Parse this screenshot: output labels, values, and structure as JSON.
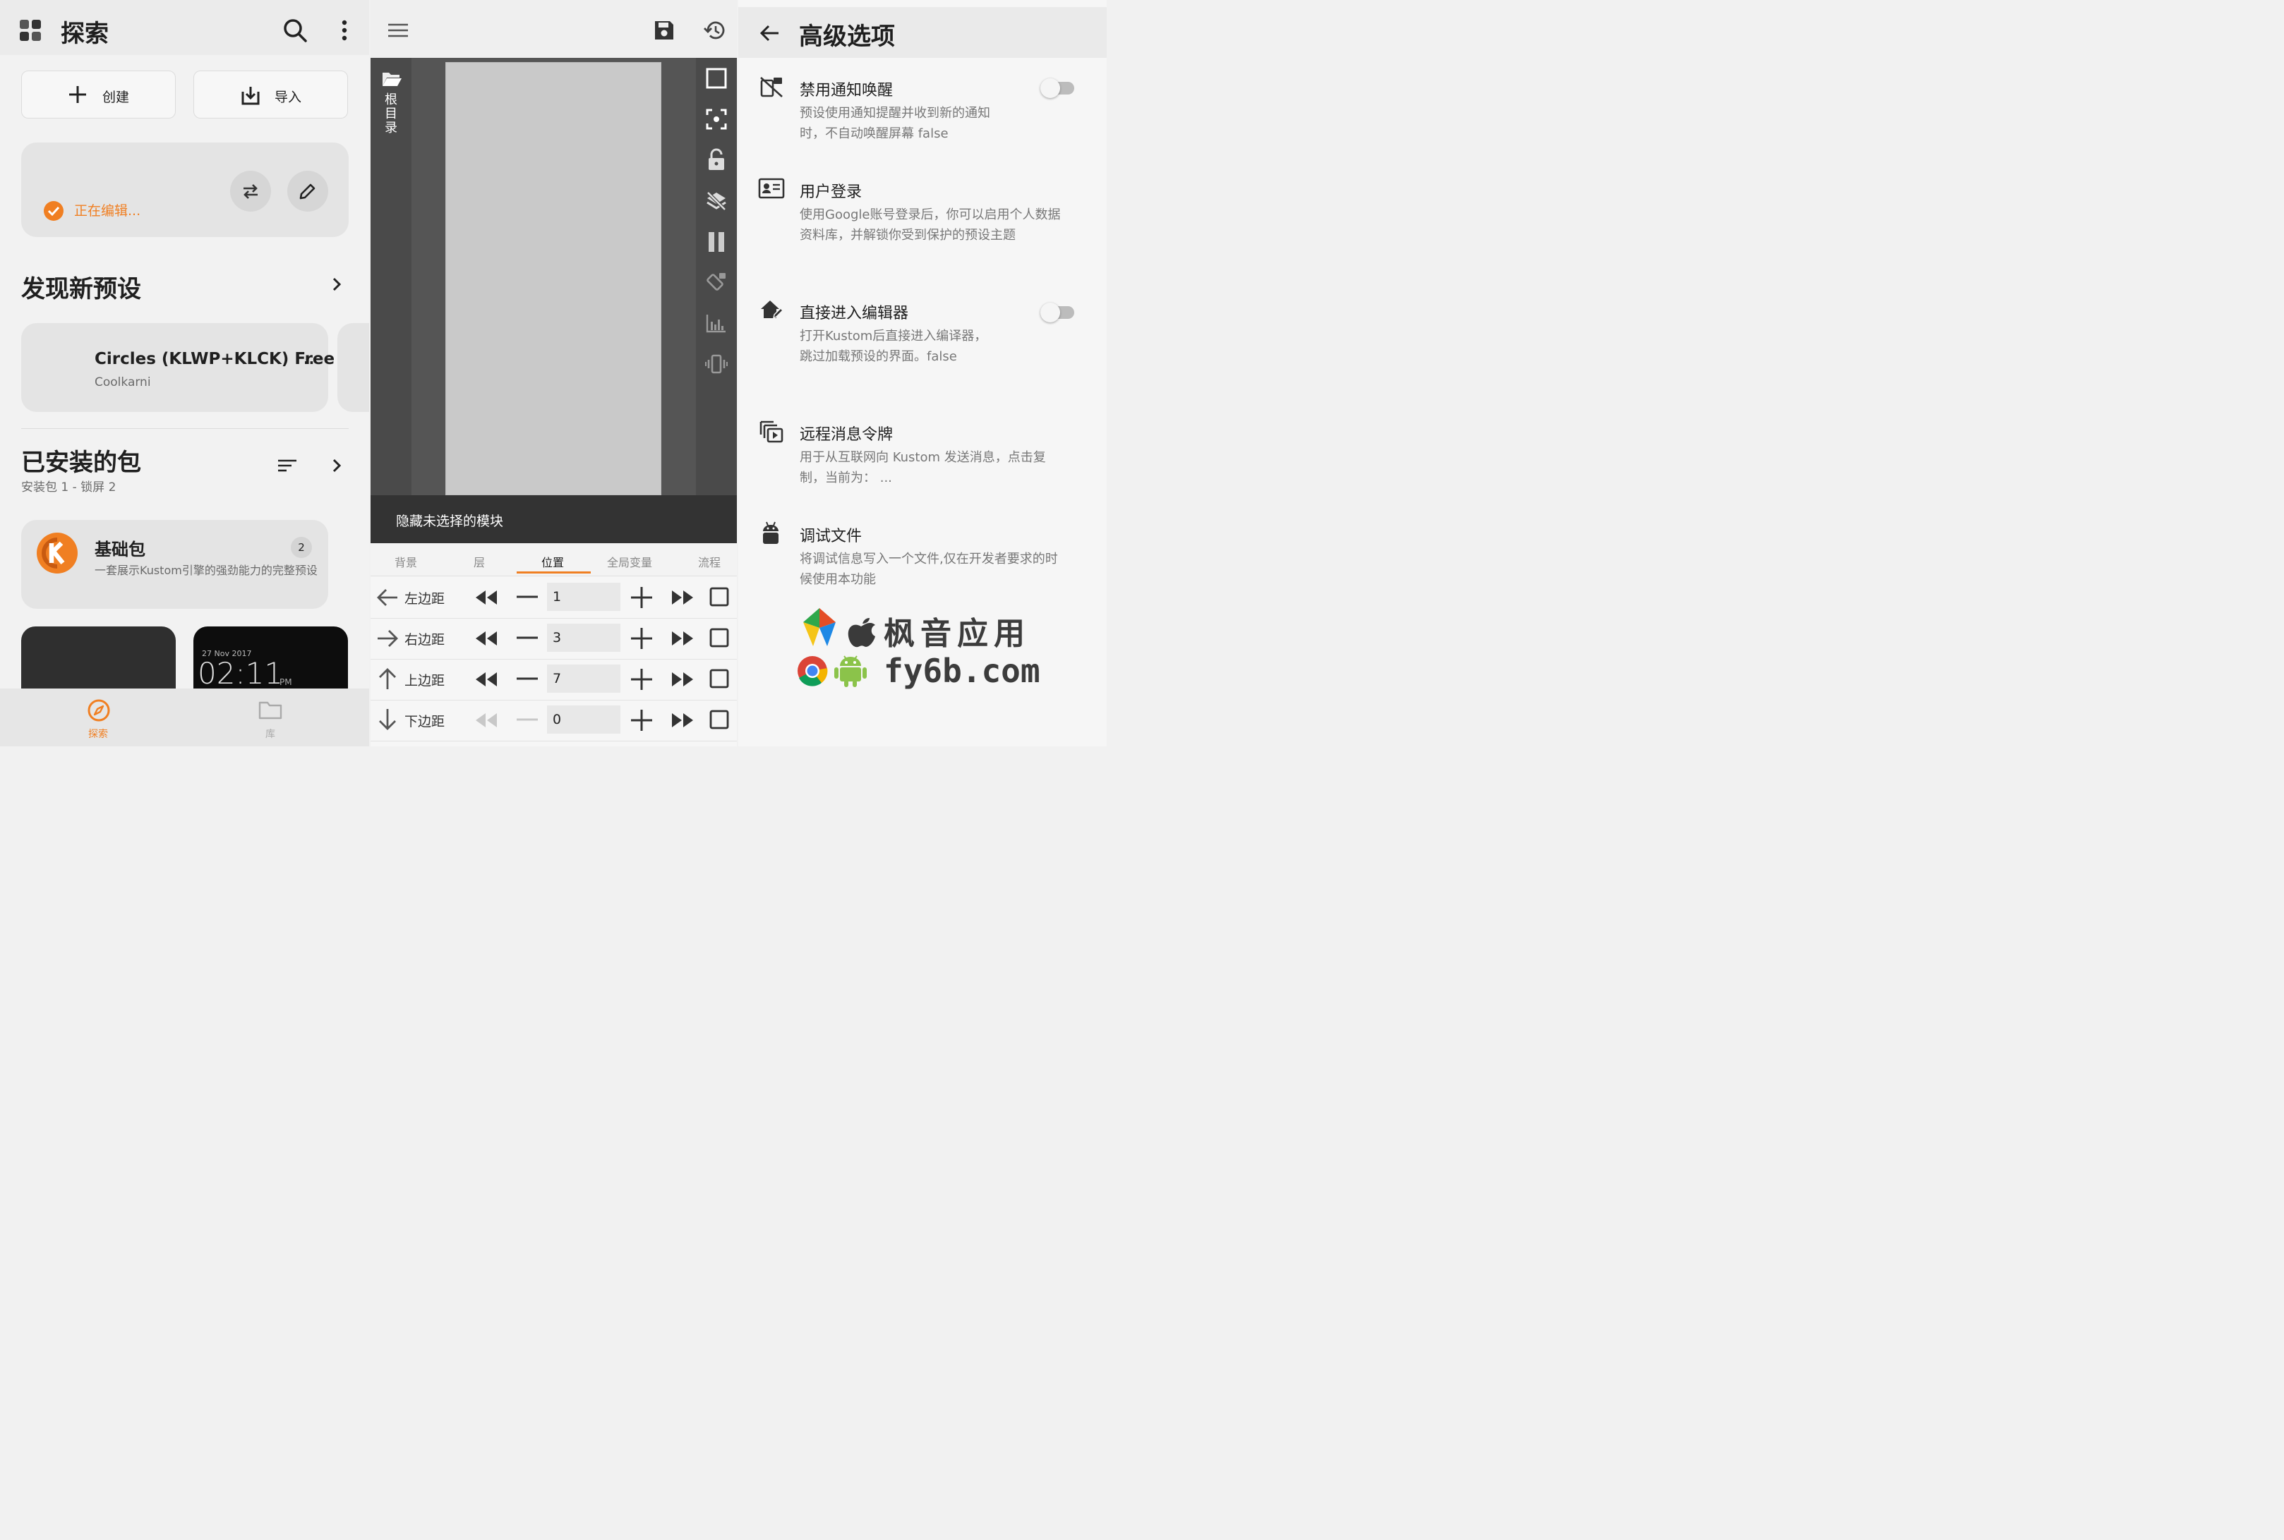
{
  "colors": {
    "accent": "#f07f22",
    "check": "#f07f22",
    "dark_bar": "#333333"
  },
  "explore": {
    "title": "探索",
    "create_label": "创建",
    "import_label": "导入",
    "editing_label": "正在编辑...",
    "discover_title": "发现新预设",
    "preset": {
      "name": "Circles (KLWP+KLCK) Free",
      "author": "Coolkarni"
    },
    "installed_title": "已安装的包",
    "installed_sub": "安装包 1 - 锁屏 2",
    "pack": {
      "name": "基础包",
      "count": "2",
      "desc": "一套展示Kustom引擎的强劲能力的完整预设"
    },
    "clock": {
      "date": "27 Nov 2017",
      "time": "02:11",
      "ampm": "PM"
    },
    "nav": [
      {
        "label": "探索"
      },
      {
        "label": "库"
      }
    ]
  },
  "editor": {
    "root_label": "根目录",
    "hide_label": "隐藏未选择的模块",
    "tabs": [
      {
        "label": "背景"
      },
      {
        "label": "层"
      },
      {
        "label": "位置"
      },
      {
        "label": "全局变量"
      },
      {
        "label": "流程"
      }
    ],
    "rows": [
      {
        "label": "左边距",
        "value": "1"
      },
      {
        "label": "右边距",
        "value": "3"
      },
      {
        "label": "上边距",
        "value": "7"
      },
      {
        "label": "下边距",
        "value": "0"
      }
    ]
  },
  "advanced": {
    "title": "高级选项",
    "options": [
      {
        "title": "禁用通知唤醒",
        "desc": "预设使用通知提醒并收到新的通知时，不自动唤醒屏幕 false"
      },
      {
        "title": "用户登录",
        "desc": "使用Google账号登录后，你可以启用个人数据资料库，并解锁你受到保护的预设主题"
      },
      {
        "title": "直接进入编辑器",
        "desc": "打开Kustom后直接进入编译器，跳过加载预设的界面。false"
      },
      {
        "title": "远程消息令牌",
        "desc": "用于从互联网向 Kustom 发送消息，点击复制，当前为： ..."
      },
      {
        "title": "调试文件",
        "desc": "将调试信息写入一个文件,仅在开发者要求的时候使用本功能"
      }
    ],
    "watermark": {
      "cn": "枫音应用",
      "site": "fy6b.com"
    }
  }
}
